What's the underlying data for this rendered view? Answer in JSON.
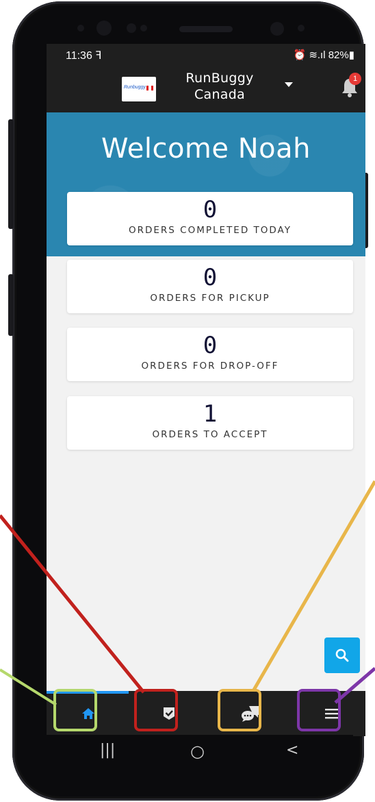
{
  "status_bar": {
    "time": "11:36",
    "sync_icon": "ꟻ",
    "right": "⏰ ≋.ıl 82%▮"
  },
  "header": {
    "title_line1": "RunBuggy",
    "title_line2": "Canada",
    "logo_text": "Runbuggy",
    "notification_count": "1"
  },
  "banner": {
    "welcome": "Welcome Noah"
  },
  "stats": [
    {
      "value": "0",
      "label": "ORDERS COMPLETED TODAY"
    },
    {
      "value": "0",
      "label": "ORDERS FOR PICKUP"
    },
    {
      "value": "0",
      "label": "ORDERS FOR DROP-OFF"
    },
    {
      "value": "1",
      "label": "ORDERS TO ACCEPT"
    }
  ],
  "bottom_nav": [
    {
      "name": "home",
      "icon": "home-icon"
    },
    {
      "name": "orders",
      "icon": "checked-badge-icon"
    },
    {
      "name": "chat",
      "icon": "chat-icon"
    },
    {
      "name": "menu",
      "icon": "hamburger-menu-icon"
    }
  ],
  "system_nav": {
    "recents": "|||",
    "home": "○",
    "back": "<"
  },
  "colors": {
    "banner": "#2a86b0",
    "accent_blue": "#11a6e8",
    "nav_bg": "#1f1f1f",
    "annotation_green": "#b5d86c",
    "annotation_red": "#c1211d",
    "annotation_yellow": "#e8b64a",
    "annotation_purple": "#7d36a8"
  }
}
